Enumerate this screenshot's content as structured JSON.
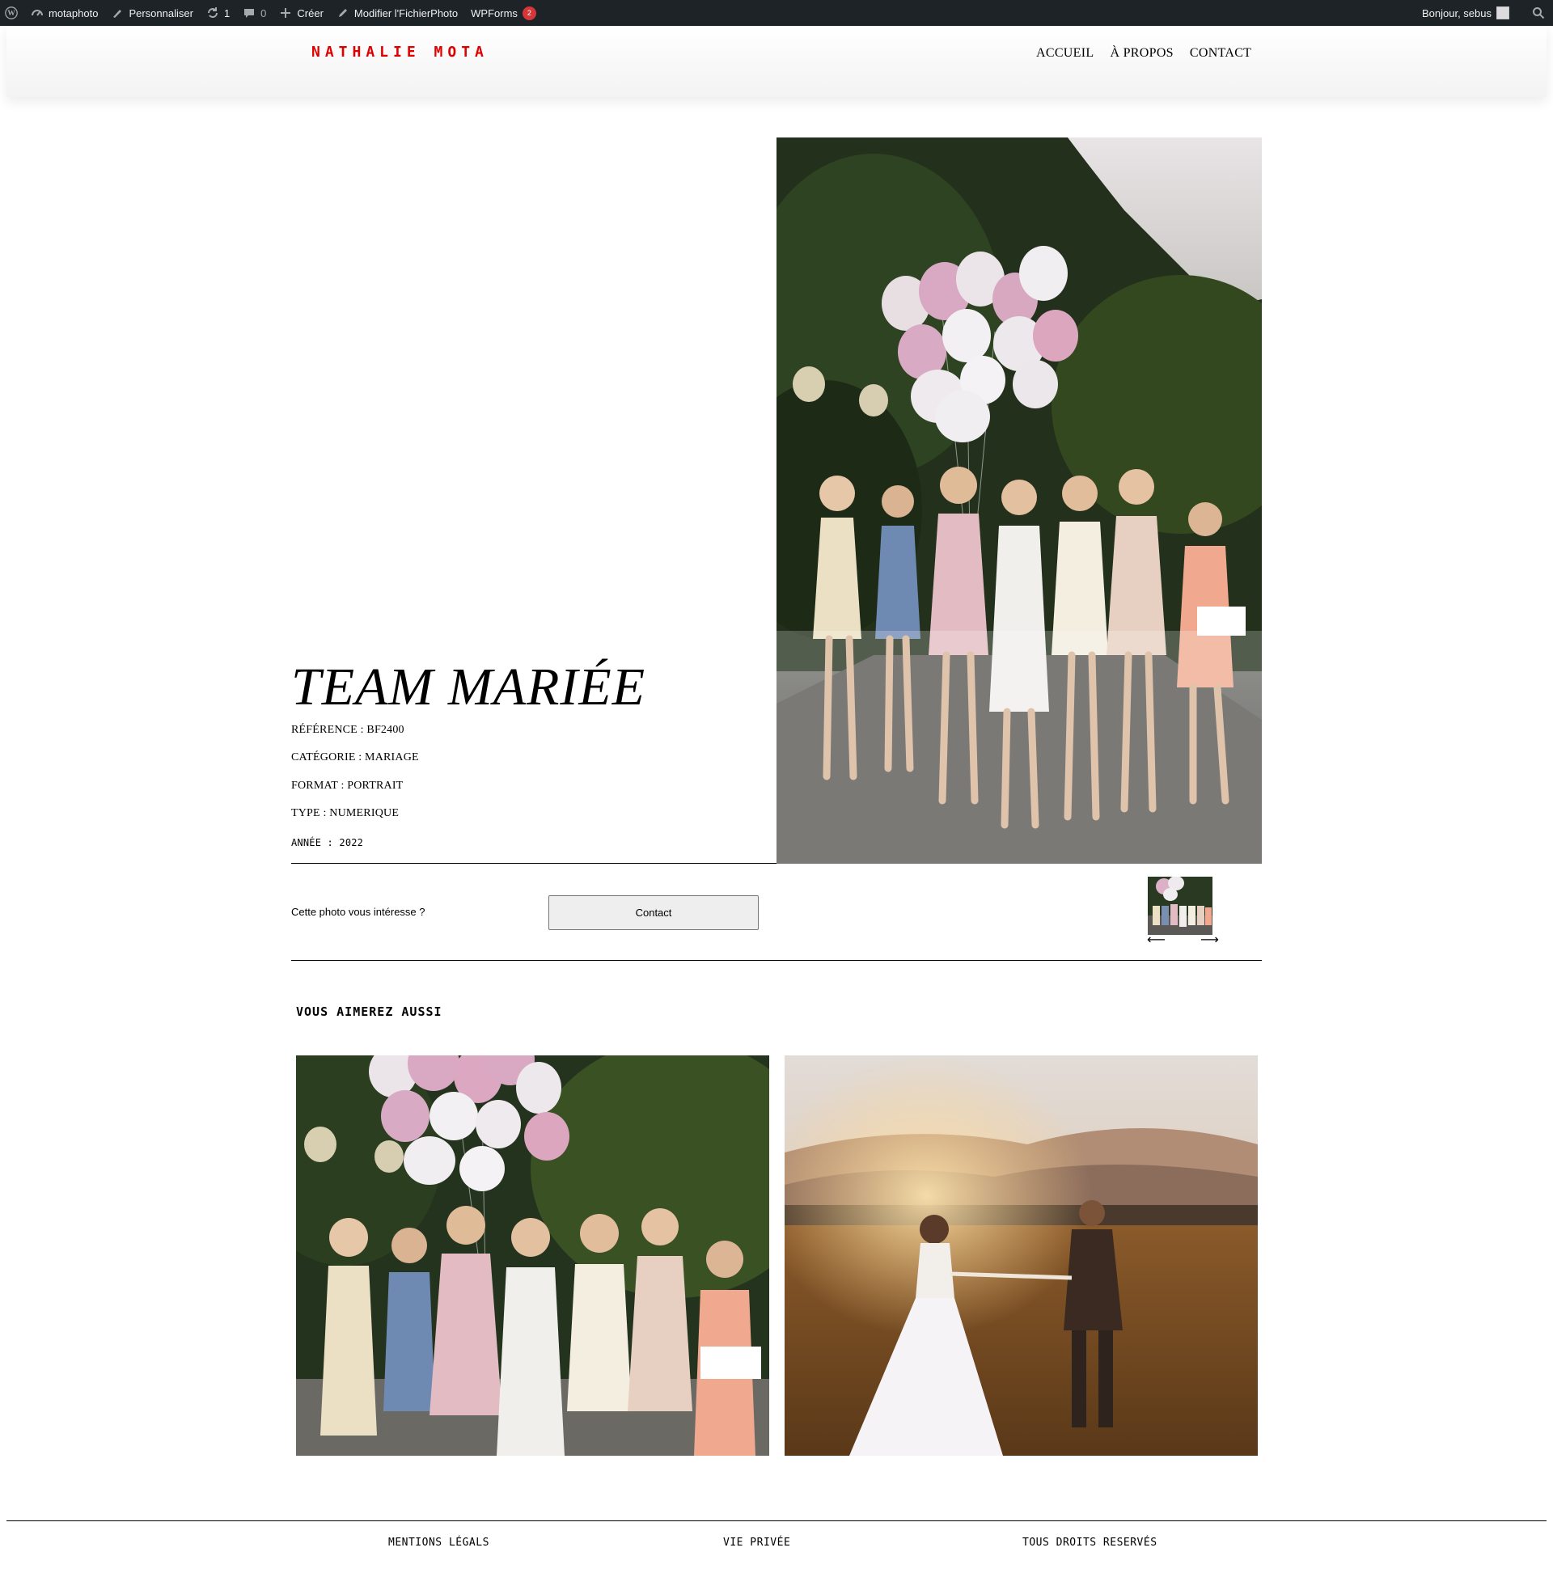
{
  "admin_bar": {
    "site_name": "motaphoto",
    "customize": "Personnaliser",
    "updates_count": "1",
    "comments_count": "0",
    "create": "Créer",
    "edit": "Modifier l'FichierPhoto",
    "wpforms": "WPForms",
    "wpforms_badge": "2",
    "greeting": "Bonjour, sebus"
  },
  "header": {
    "logo": "NATHALIE MOTA",
    "nav": [
      "ACCUEIL",
      "À PROPOS",
      "CONTACT"
    ]
  },
  "photo": {
    "title": "TEAM MARIÉE",
    "reference": "RÉFÉRENCE : BF2400",
    "category": "CATÉGORIE : MARIAGE",
    "format": "FORMAT : PORTRAIT",
    "type": "TYPE : NUMERIQUE",
    "year": "ANNÉE : 2022"
  },
  "cta": {
    "question": "Cette photo vous intéresse ?",
    "button": "Contact",
    "prev_arrow": "⟵",
    "next_arrow": "⟶"
  },
  "related": {
    "heading": "VOUS AIMEREZ AUSSI"
  },
  "footer": {
    "links": [
      "MENTIONS LÉGALS",
      "VIE PRIVÉE",
      "TOUS DROITS RESERVÉS"
    ]
  },
  "colors": {
    "logo_red": "#e00000",
    "admin_bar_bg": "#1d2327",
    "badge_red": "#d63638"
  }
}
